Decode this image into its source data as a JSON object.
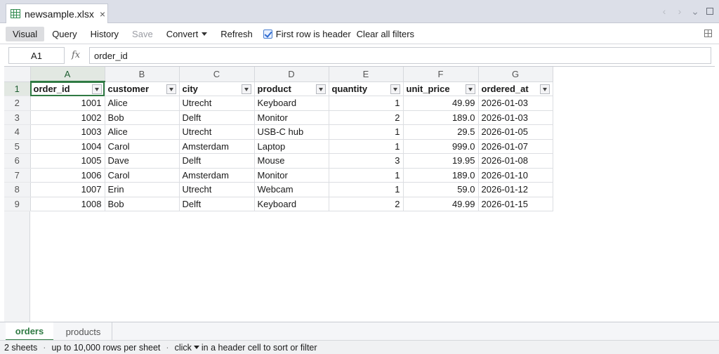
{
  "tab": {
    "filename": "newsample.xlsx",
    "close_symbol": "×",
    "icon": "spreadsheet-icon"
  },
  "window": {
    "icons": [
      "chevron-left-icon",
      "chevron-right-icon",
      "chevron-down-icon",
      "maximize-icon"
    ]
  },
  "toolbar": {
    "visual": "Visual",
    "query": "Query",
    "history": "History",
    "save": "Save",
    "convert": "Convert",
    "refresh": "Refresh",
    "first_row_header": "First row is header",
    "first_row_header_checked": true,
    "clear_filters": "Clear all filters"
  },
  "formula": {
    "cell_ref": "A1",
    "fx": "fx",
    "value": "order_id"
  },
  "grid": {
    "columns": [
      "A",
      "B",
      "C",
      "D",
      "E",
      "F",
      "G"
    ],
    "rows": [
      [
        "order_id",
        "customer",
        "city",
        "product",
        "quantity",
        "unit_price",
        "ordered_at"
      ],
      [
        "1001",
        "Alice",
        "Utrecht",
        "Keyboard",
        "1",
        "49.99",
        "2026-01-03"
      ],
      [
        "1002",
        "Bob",
        "Delft",
        "Monitor",
        "2",
        "189.0",
        "2026-01-03"
      ],
      [
        "1003",
        "Alice",
        "Utrecht",
        "USB-C hub",
        "1",
        "29.5",
        "2026-01-05"
      ],
      [
        "1004",
        "Carol",
        "Amsterdam",
        "Laptop",
        "1",
        "999.0",
        "2026-01-07"
      ],
      [
        "1005",
        "Dave",
        "Delft",
        "Mouse",
        "3",
        "19.95",
        "2026-01-08"
      ],
      [
        "1006",
        "Carol",
        "Amsterdam",
        "Monitor",
        "1",
        "189.0",
        "2026-01-10"
      ],
      [
        "1007",
        "Erin",
        "Utrecht",
        "Webcam",
        "1",
        "59.0",
        "2026-01-12"
      ],
      [
        "1008",
        "Bob",
        "Delft",
        "Keyboard",
        "2",
        "49.99",
        "2026-01-15"
      ]
    ],
    "numeric_columns": [
      0,
      4,
      5
    ]
  },
  "sheets": {
    "active": "orders",
    "other": "products"
  },
  "status": {
    "sheets": "2 sheets",
    "rows": "up to 10,000 rows per sheet",
    "hint_pre": "click",
    "hint_post": "in a header cell to sort or filter",
    "separator": "·"
  },
  "colors": {
    "accent": "#2f7a43",
    "checkbox": "#2f6bd0"
  }
}
